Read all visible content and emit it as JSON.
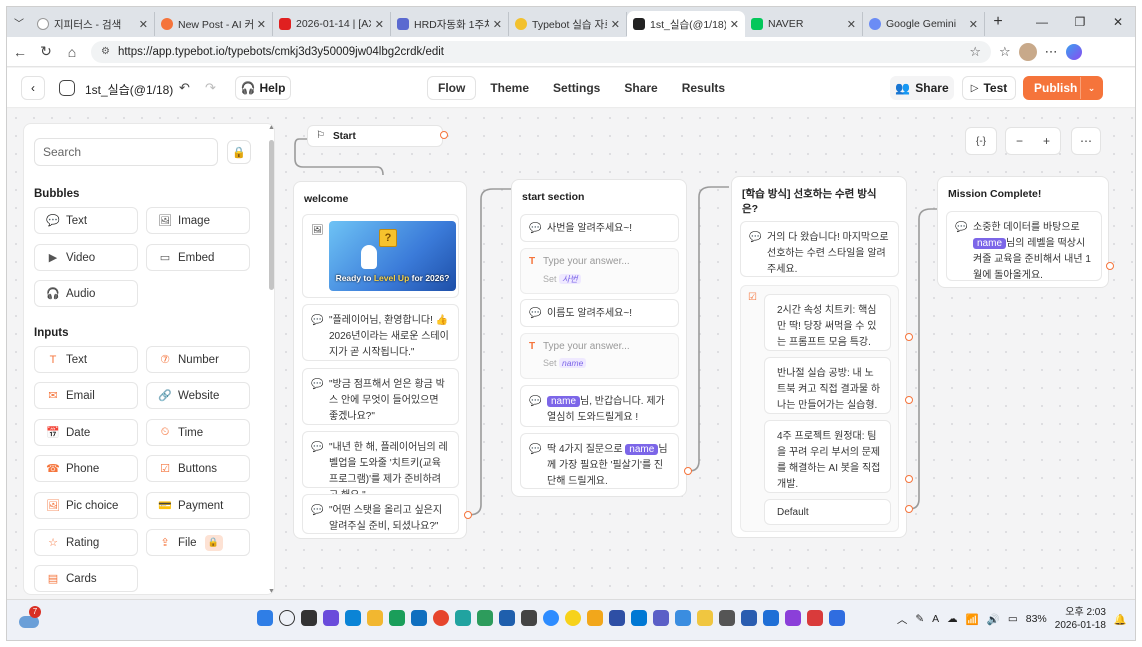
{
  "browser": {
    "tabs": [
      {
        "title": "지피터스 - 검색",
        "fav": "#888"
      },
      {
        "title": "New Post - AI 커뮤니",
        "fav": "#f5743b"
      },
      {
        "title": "2026-01-14 | [AX] H",
        "fav": "#e02020"
      },
      {
        "title": "HRD자동화 1주차 강",
        "fav": "#5b6ad0"
      },
      {
        "title": "Typebot 실습 자료",
        "fav": "#f2c12e"
      },
      {
        "title": "1st_실습(@1/18) | T",
        "fav": "#222"
      },
      {
        "title": "NAVER",
        "fav": "#03c75a"
      },
      {
        "title": "Google Gemini",
        "fav": "#6b8cf5"
      }
    ],
    "url": "https://app.typebot.io/typebots/cmkj3d3y50009jw04lbg2crdk/edit"
  },
  "header": {
    "bot_name": "1st_실습(@1/18)",
    "help": "Help",
    "tabs": [
      "Flow",
      "Theme",
      "Settings",
      "Share",
      "Results"
    ],
    "share": "Share",
    "test": "Test",
    "publish": "Publish",
    "accent": "#f5743b"
  },
  "sidebar": {
    "search_placeholder": "Search",
    "bubbles_title": "Bubbles",
    "bubbles": [
      "Text",
      "Image",
      "Video",
      "Embed",
      "Audio"
    ],
    "inputs_title": "Inputs",
    "inputs": [
      "Text",
      "Number",
      "Email",
      "Website",
      "Date",
      "Time",
      "Phone",
      "Buttons",
      "Pic choice",
      "Payment",
      "Rating",
      "File",
      "Cards"
    ]
  },
  "canvas": {
    "start_label": "Start",
    "variables_icon": "{-}",
    "welcome": {
      "title": "welcome",
      "image_line1": "Ready to ",
      "image_highlight": "Level Up",
      "image_line2": " for 2026?",
      "texts": [
        "\"플레이어님, 환영합니다! 👍 2026년이라는 새로운 스테이지가 곧 시작됩니다.\"",
        "\"방금 점프해서 얻은 황금 박스 안에 무엇이 들어있으면 좋겠나요?\"",
        "\"내년 한 해, 플레이어님의 레벨업을 도와줄 '치트키(교육 프로그램)'를 제가 준비하려고 해요.\"",
        "\"어떤 스탯을 올리고 싶은지 알려주실 준비, 되셨나요?\""
      ]
    },
    "start_section": {
      "title": "start section",
      "ask_num": "사번을 알려주세요~!",
      "input_placeholder": "Type your answer...",
      "set_label": "Set",
      "var_num": "사번",
      "ask_name": "이름도 알려주세요~!",
      "var_name": "name",
      "greet_tag": "name",
      "greet_rest": "님, 반갑습니다. 제가 열심히 도와드릴게요 !",
      "q_pre": "딱 4가지 질문으로 ",
      "q_tag": "name",
      "q_post": "님께 가장 필요한 '필살기'를 진단해 드릴게요."
    },
    "learning": {
      "title": "[학습 방식] 선호하는 수련 방식은?",
      "ask": "거의 다 왔습니다! 마지막으로 선호하는 수련 스타일을 알려주세요.",
      "options": [
        "2시간 속성 치트키: 핵심만 딱! 당장 써먹을 수 있는 프롬프트 모음 특강.",
        "반나절 실습 공방: 내 노트북 켜고 직접 결과물 하나는 만들어가는 실습형.",
        "4주 프로젝트 원정대: 팀을 꾸려 우리 부서의 문제를 해결하는 AI 봇을 직접 개발."
      ],
      "default": "Default"
    },
    "mission": {
      "title": "Mission Complete!",
      "pre": "소중한 데이터를 바탕으로 ",
      "tag": "name",
      "post": "님의 레벨을 떡상시켜줄 교육을 준비해서 내년 1월에 돌아올게요."
    }
  },
  "taskbar": {
    "weather_badge": "7",
    "battery": "83%",
    "time": "오후 2:03",
    "date": "2026-01-18"
  }
}
